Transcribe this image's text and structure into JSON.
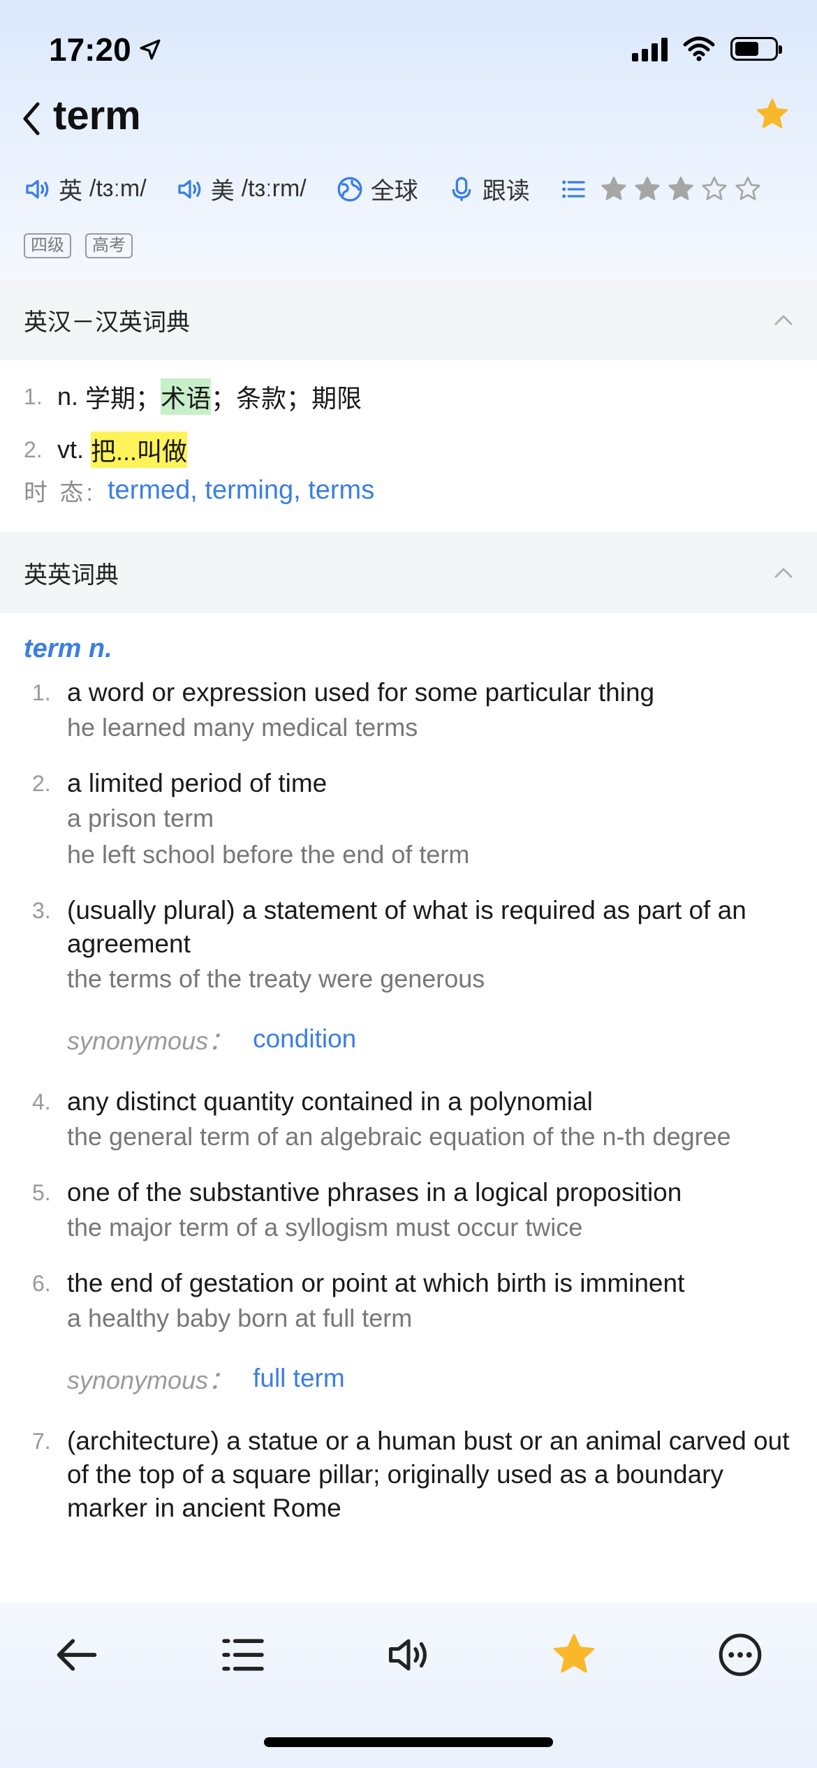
{
  "status_bar": {
    "time": "17:20"
  },
  "header": {
    "title": "term"
  },
  "pronunciations": [
    {
      "region": "英",
      "ipa": "/tɜːm/"
    },
    {
      "region": "美",
      "ipa": "/tɜːrm/"
    }
  ],
  "actions": {
    "global": "全球",
    "follow_read": "跟读"
  },
  "rating": {
    "filled": 3,
    "total": 5
  },
  "tags": [
    "四级",
    "高考"
  ],
  "sections": {
    "ec_dict": {
      "title": "英汉－汉英词典",
      "defs": [
        {
          "num": "1.",
          "pos": "n.",
          "text_before": "学期；",
          "highlight": "术语",
          "text_after": "；条款；期限"
        },
        {
          "num": "2.",
          "pos": "vt.",
          "highlight": "把...叫做"
        }
      ],
      "tense_label": "时 态:",
      "tense_forms": "termed, terming, terms"
    },
    "ee_dict": {
      "title": "英英词典",
      "headword": "term n.",
      "synonym_label": "synonymous：",
      "entries": [
        {
          "num": "1.",
          "def": "a word or expression used for some particular thing",
          "examples": [
            "he learned many medical terms"
          ]
        },
        {
          "num": "2.",
          "def": "a limited period of time",
          "examples": [
            "a prison term",
            "he left school before the end of term"
          ]
        },
        {
          "num": "3.",
          "def": "(usually plural) a statement of what is required as part of an agreement",
          "examples": [
            "the terms of the treaty were generous"
          ],
          "synonym": "condition"
        },
        {
          "num": "4.",
          "def": "any distinct quantity contained in a polynomial",
          "examples": [
            "the general term of an algebraic equation of the n-th degree"
          ]
        },
        {
          "num": "5.",
          "def": "one of the substantive phrases in a logical proposition",
          "examples": [
            "the major term of a syllogism must occur twice"
          ]
        },
        {
          "num": "6.",
          "def": "the end of gestation or point at which birth is imminent",
          "examples": [
            "a healthy baby born at full term"
          ],
          "synonym": "full term"
        },
        {
          "num": "7.",
          "def": "(architecture) a statue or a human bust or an animal carved out of the top of a square pillar; originally used as a boundary marker in ancient Rome",
          "examples": []
        }
      ]
    }
  },
  "colors": {
    "accent": "#3a7ee4",
    "star": "#f9b72a",
    "highlight_green": "#c8efc9",
    "highlight_yellow": "#fff35a"
  }
}
